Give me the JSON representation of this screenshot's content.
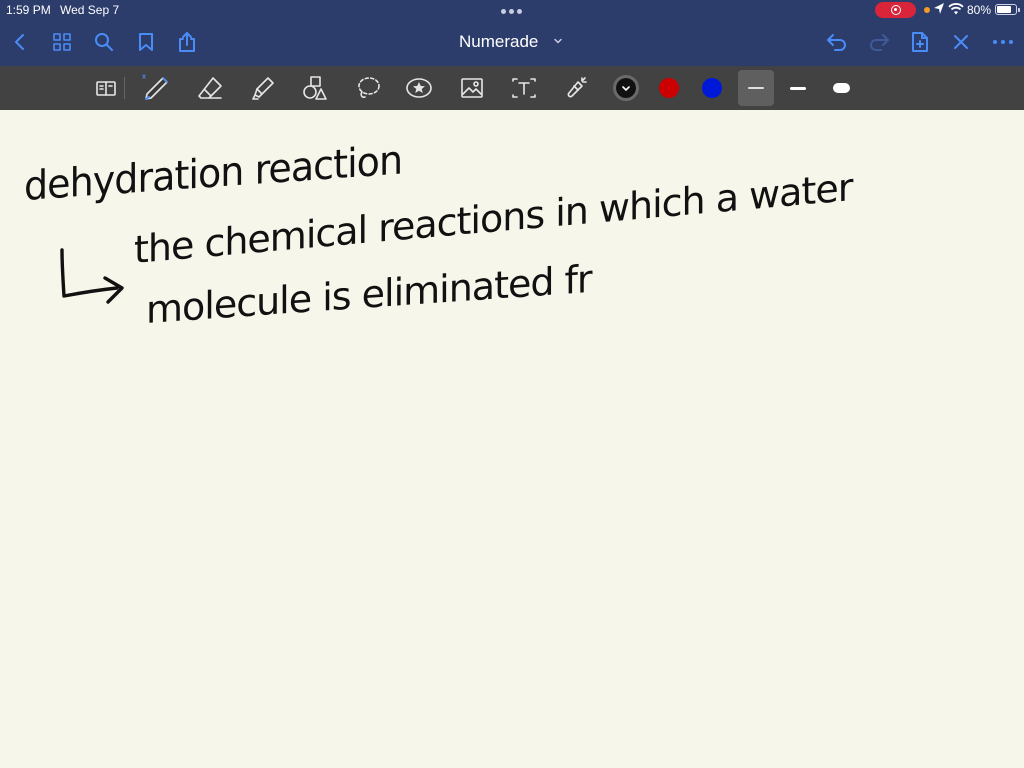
{
  "status": {
    "time": "1:59 PM",
    "date": "Wed Sep 7",
    "battery": "80%",
    "battery_level": 0.8
  },
  "nav": {
    "title": "Numerade",
    "icons": [
      "back-icon",
      "grid-icon",
      "search-icon",
      "bookmark-icon",
      "share-icon",
      "undo-icon",
      "redo-icon",
      "add-page-icon",
      "close-icon",
      "more-icon"
    ]
  },
  "toolbar": {
    "tools": [
      "read-only-icon",
      "pen-icon",
      "eraser-icon",
      "highlighter-icon",
      "shapes-icon",
      "lasso-icon",
      "sticker-icon",
      "image-icon",
      "text-icon",
      "laser-pointer-icon"
    ],
    "colors": [
      "#111111",
      "#cc0000",
      "#0019d9"
    ],
    "selected_color": "#111111",
    "stroke_widths": [
      "thin",
      "medium",
      "thick"
    ],
    "selected_stroke": "thin"
  },
  "note": {
    "heading": "dehydration reaction",
    "line1": "the chemical reactions in which a water",
    "line2": "molecule is eliminated fr"
  }
}
